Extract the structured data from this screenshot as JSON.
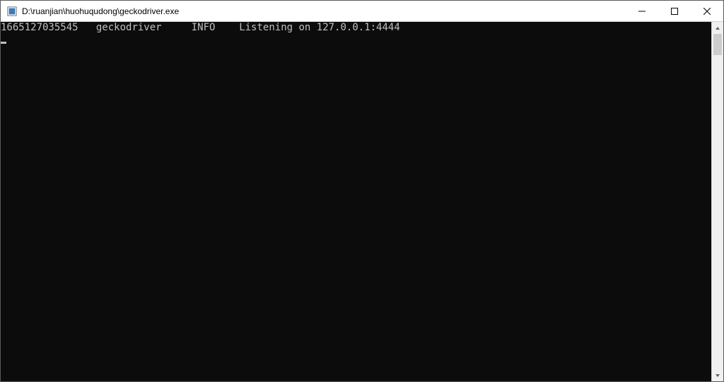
{
  "window": {
    "title": "D:\\ruanjian\\huohuqudong\\geckodriver.exe"
  },
  "console": {
    "lines": [
      {
        "timestamp": "1665127035545",
        "component": "geckodriver",
        "level": "INFO",
        "message": "Listening on 127.0.0.1:4444"
      }
    ]
  }
}
